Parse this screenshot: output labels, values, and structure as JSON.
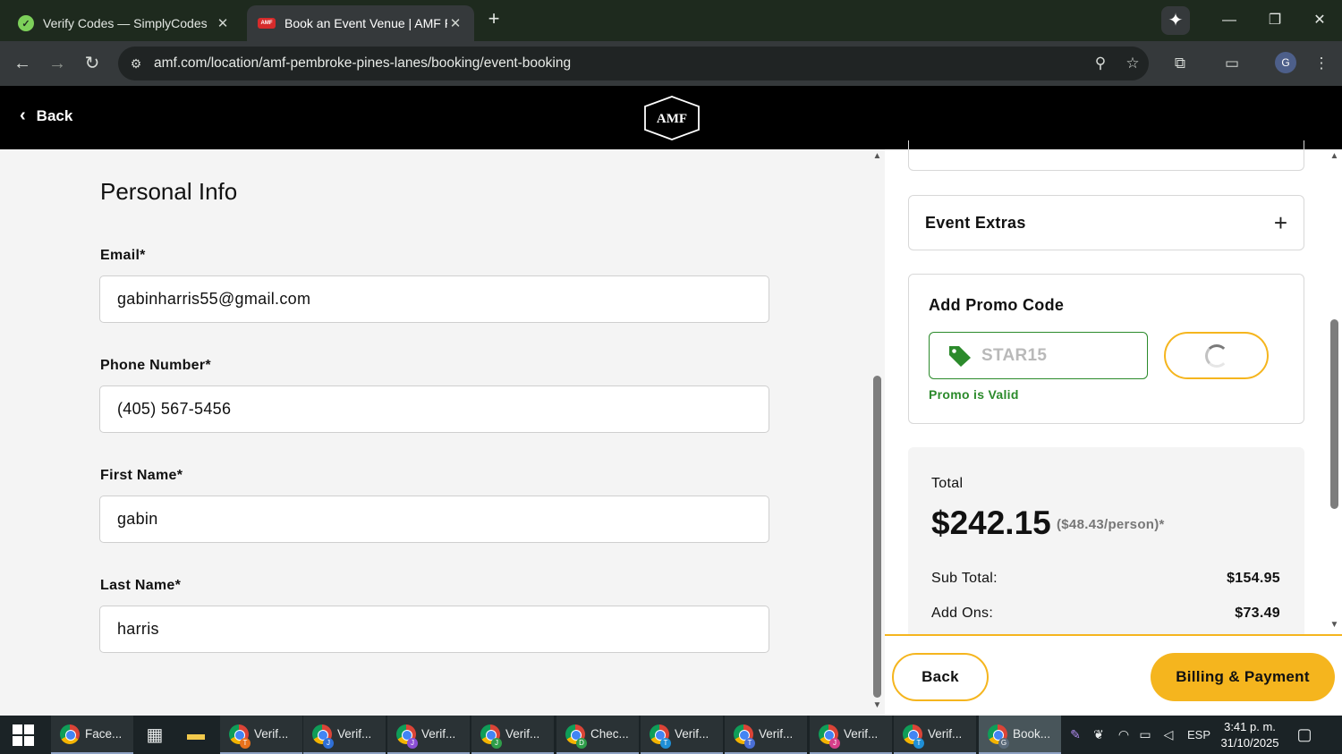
{
  "browser": {
    "tabs": [
      {
        "label": "Verify Codes — SimplyCodes",
        "active": false
      },
      {
        "label": "Book an Event Venue | AMF Pembroke Pines Lanes",
        "active": true
      }
    ],
    "url": "amf.com/location/amf-pembroke-pines-lanes/booking/event-booking",
    "profile_initial": "G"
  },
  "site": {
    "back_label": "Back",
    "logo_text": "AMF"
  },
  "form": {
    "title": "Personal Info",
    "email_label": "Email*",
    "email_value": "gabinharris55@gmail.com",
    "phone_label": "Phone Number*",
    "phone_value": "(405) 567-5456",
    "first_label": "First Name*",
    "first_value": "gabin",
    "last_label": "Last Name*",
    "last_value": "harris"
  },
  "summary": {
    "extras_title": "Event Extras",
    "promo_title": "Add Promo Code",
    "promo_code": "STAR15",
    "promo_status": "Promo is Valid",
    "total_label": "Total",
    "total_amount": "$242.15",
    "per_person": "($48.43/person)*",
    "subtotal_label": "Sub Total:",
    "subtotal_value": "$154.95",
    "addons_label": "Add Ons:",
    "addons_value": "$73.49"
  },
  "footer": {
    "back_label": "Back",
    "billing_label": "Billing & Payment"
  },
  "taskbar": {
    "items": [
      {
        "label": "Face...",
        "badge": "",
        "active": false
      },
      {
        "label": "Verif...",
        "badge": "T",
        "active": false
      },
      {
        "label": "Verif...",
        "badge": "J",
        "active": false
      },
      {
        "label": "Verif...",
        "badge": "J",
        "active": false
      },
      {
        "label": "Verif...",
        "badge": "J",
        "active": false
      },
      {
        "label": "Chec...",
        "badge": "D",
        "active": false
      },
      {
        "label": "Verif...",
        "badge": "T",
        "active": false
      },
      {
        "label": "Verif...",
        "badge": "T",
        "active": false
      },
      {
        "label": "Verif...",
        "badge": "J",
        "active": false
      },
      {
        "label": "Verif...",
        "badge": "T",
        "active": false
      },
      {
        "label": "Book...",
        "badge": "G",
        "active": true
      }
    ],
    "lang": "ESP",
    "time": "3:41 p. m.",
    "date": "31/10/2025"
  },
  "colors": {
    "accent": "#f5b51e",
    "valid_green": "#2b8a2b"
  }
}
